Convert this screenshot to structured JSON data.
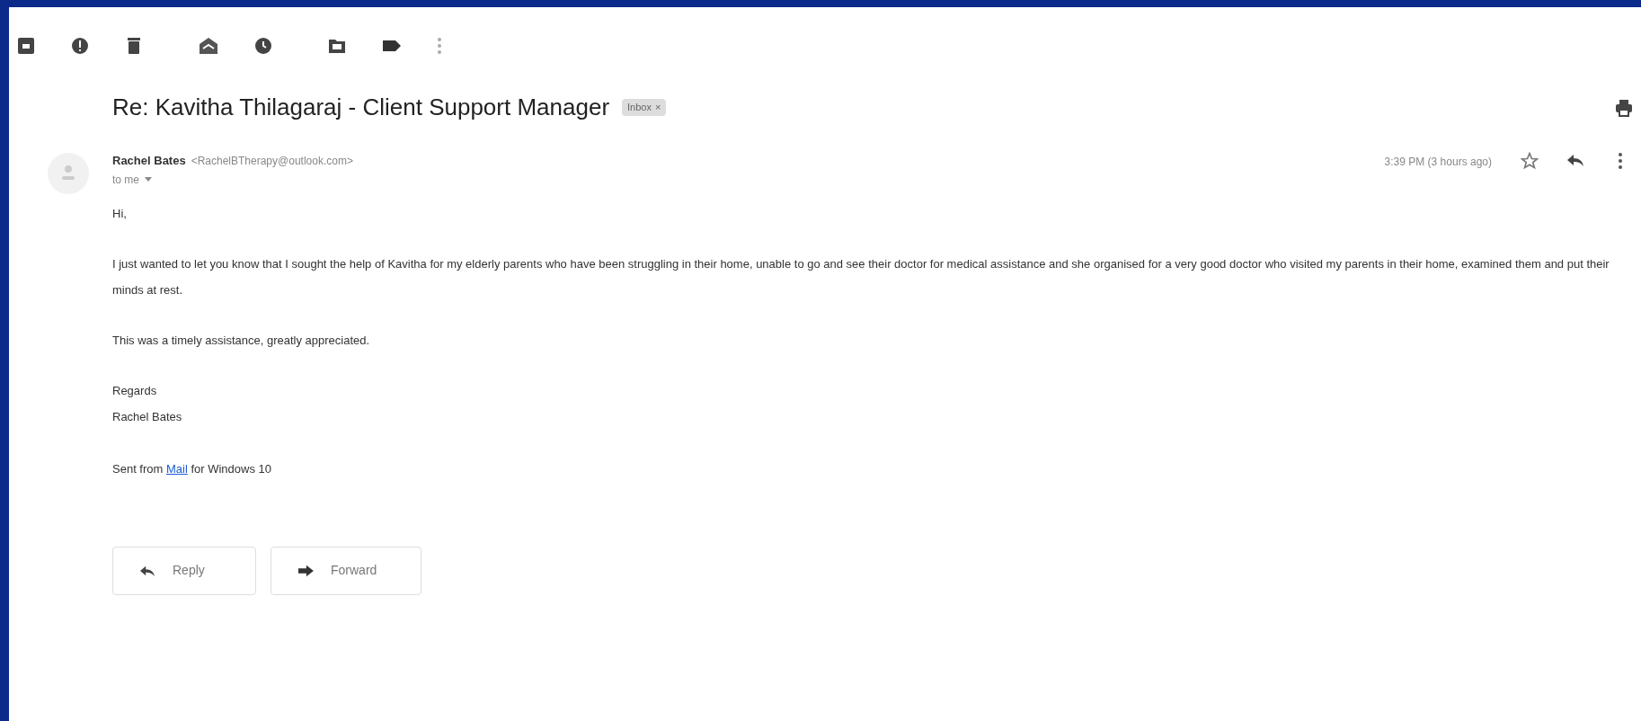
{
  "subject": {
    "title": "Re: Kavitha Thilagaraj - Client Support Manager",
    "label": "Inbox",
    "label_close": "×"
  },
  "message": {
    "sender_name": "Rachel Bates",
    "sender_email": "<RachelBTherapy@outlook.com>",
    "recipient": "to me",
    "time": "3:39 PM (3 hours ago)",
    "starred": false,
    "greeting": "Hi,",
    "paragraphs": [
      "I just wanted to let you know that I sought the help of Kavitha for my elderly parents who have been struggling in their home, unable to go and see their doctor for medical assistance and she organised for a very good doctor who visited my parents in their home, examined them and put their minds at rest.",
      "This was a timely assistance, greatly appreciated."
    ],
    "closing": "Regards",
    "signature": "Rachel Bates",
    "footer": {
      "before": "Sent from",
      "link": "Mail",
      "after": "for Windows 10"
    }
  },
  "actions": [
    "Reply",
    "Forward"
  ]
}
